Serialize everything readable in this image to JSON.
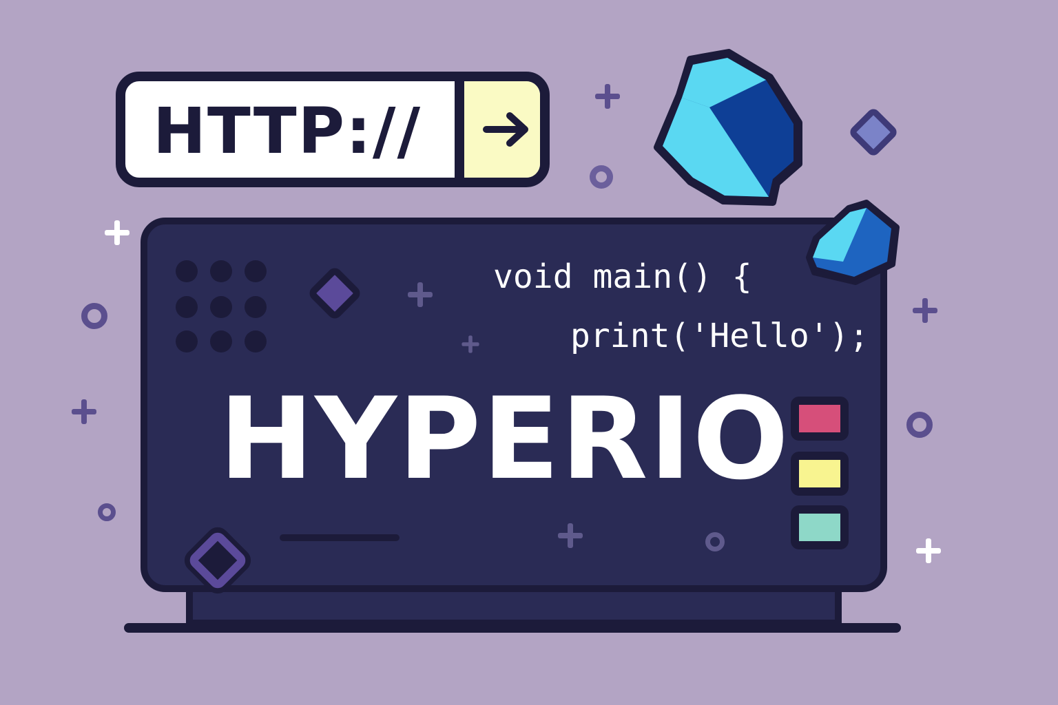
{
  "url_bar": {
    "text": "HTTP://",
    "go_icon": "arrow-right-icon"
  },
  "code": {
    "line1": "void main() {",
    "line2": "print('Hello');"
  },
  "brand": {
    "title": "HYPERIO"
  },
  "swatches": [
    "#d64f7a",
    "#f8f490",
    "#8ed8c8"
  ],
  "colors": {
    "background": "#b3a4c4",
    "outline": "#1c1b3a",
    "screen": "#2a2b55",
    "accent_purple": "#5b4a9a",
    "gem_light": "#5ad8f2",
    "gem_dark": "#0e3f96",
    "url_go_button": "#fafac4"
  }
}
